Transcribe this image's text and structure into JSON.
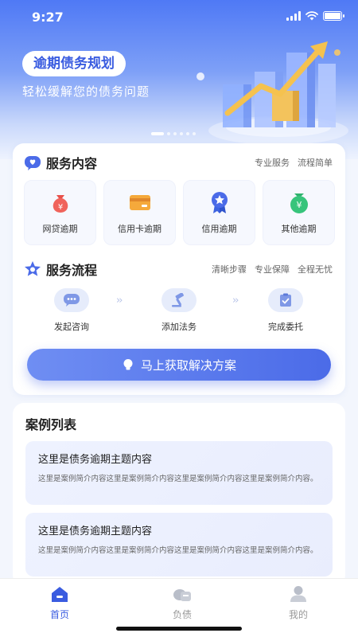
{
  "status_bar": {
    "time": "9:27"
  },
  "hero": {
    "title": "逾期债务规划",
    "subtitle": "轻松缓解您的债务问题",
    "carousel_total": 6,
    "carousel_active": 1
  },
  "services_section": {
    "title": "服务内容",
    "tags": [
      "专业服务",
      "流程简单"
    ],
    "items": [
      {
        "label": "网贷逾期",
        "icon": "money-bag-icon"
      },
      {
        "label": "信用卡逾期",
        "icon": "credit-card-icon"
      },
      {
        "label": "信用逾期",
        "icon": "badge-icon"
      },
      {
        "label": "其他逾期",
        "icon": "coin-bag-icon"
      }
    ]
  },
  "process_section": {
    "title": "服务流程",
    "tags": [
      "清晰步骤",
      "专业保障",
      "全程无忧"
    ],
    "steps": [
      {
        "label": "发起咨询",
        "icon": "chat-icon"
      },
      {
        "label": "添加法务",
        "icon": "gavel-icon"
      },
      {
        "label": "完成委托",
        "icon": "clipboard-icon"
      }
    ]
  },
  "cta": {
    "label": "马上获取解决方案"
  },
  "cases": {
    "title": "案例列表",
    "items": [
      {
        "title": "这里是债务逾期主题内容",
        "desc": "这里是案例简介内容这里是案例简介内容这里是案例简介内容这里是案例简介内容。"
      },
      {
        "title": "这里是债务逾期主题内容",
        "desc": "这里是案例简介内容这里是案例简介内容这里是案例简介内容这里是案例简介内容。"
      }
    ]
  },
  "bottom_nav": {
    "items": [
      {
        "label": "首页",
        "icon": "home-icon",
        "active": true
      },
      {
        "label": "负债",
        "icon": "debt-icon",
        "active": false
      },
      {
        "label": "我的",
        "icon": "profile-icon",
        "active": false
      }
    ]
  },
  "colors": {
    "primary": "#4b6be8",
    "accent_text": "#3a5ce0",
    "background": "#f3f6fd"
  }
}
